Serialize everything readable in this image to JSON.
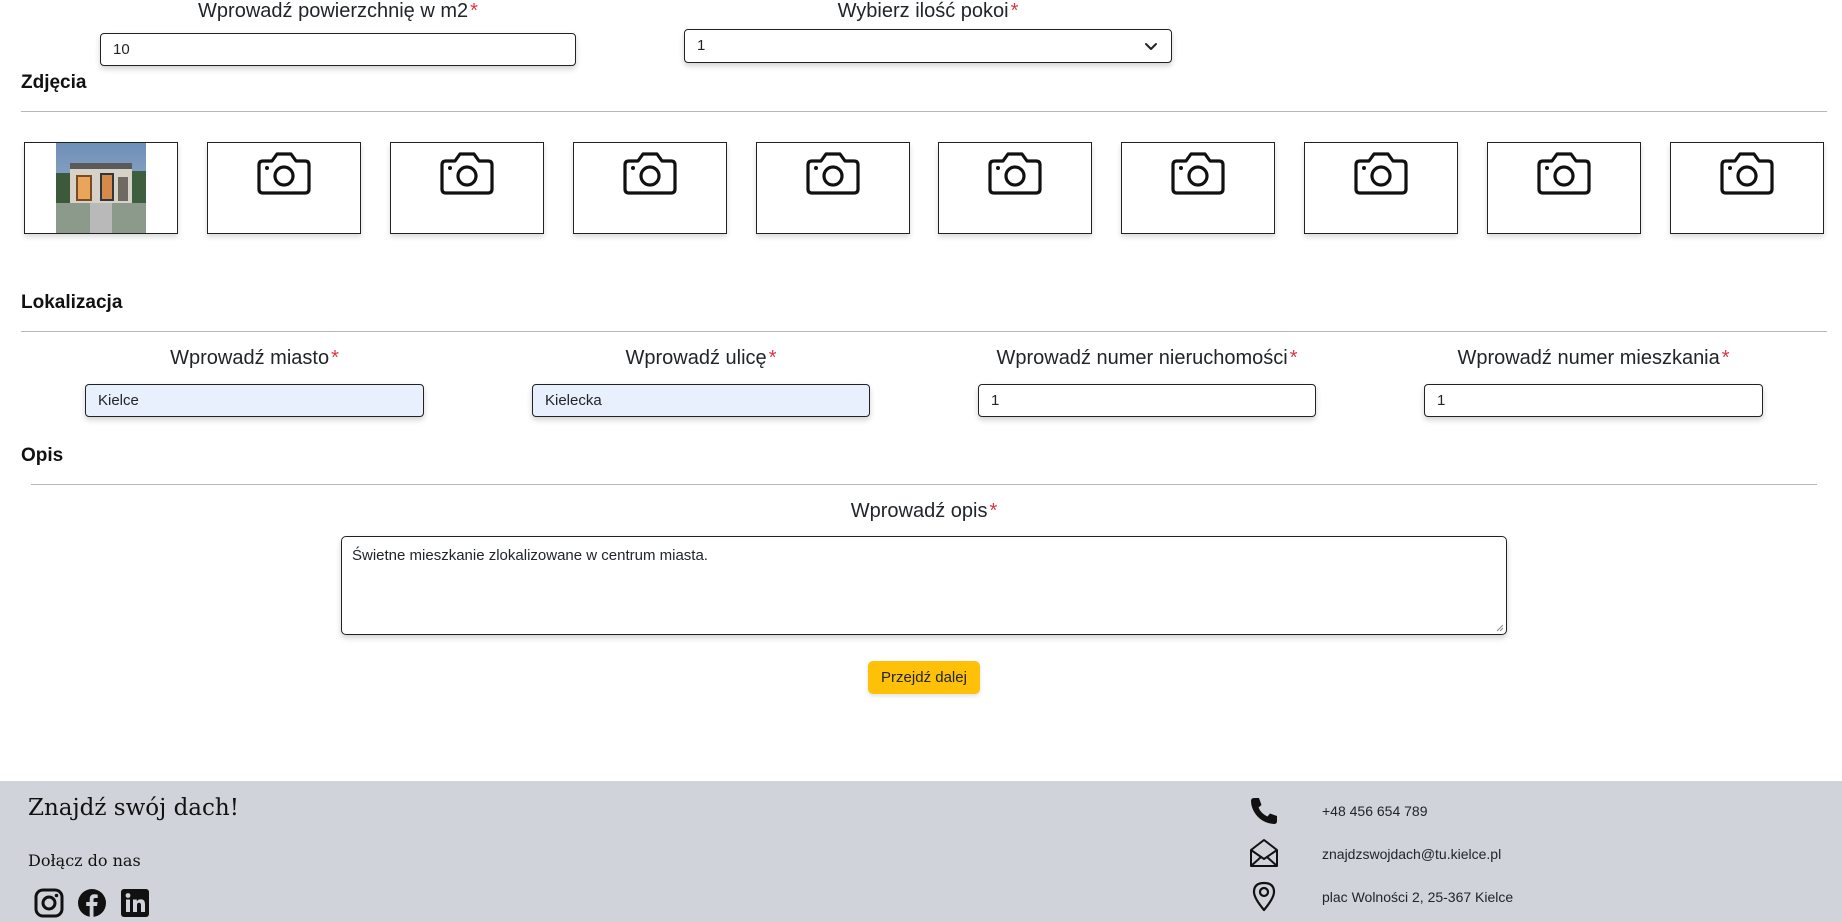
{
  "form": {
    "area": {
      "label": "Wprowadź powierzchnię w m2",
      "required": "*",
      "value": "10"
    },
    "rooms": {
      "label": "Wybierz ilość pokoi",
      "required": "*",
      "value": "1"
    }
  },
  "photos": {
    "title": "Zdjęcia",
    "slots": 10,
    "filled": 1,
    "icon": "camera-icon"
  },
  "location": {
    "title": "Lokalizacja",
    "city": {
      "label": "Wprowadź miasto",
      "required": "*",
      "value": "Kielce"
    },
    "street": {
      "label": "Wprowadź ulicę",
      "required": "*",
      "value": "Kielecka"
    },
    "property_number": {
      "label": "Wprowadź numer nieruchomości",
      "required": "*",
      "value": "1"
    },
    "apartment_number": {
      "label": "Wprowadź numer mieszkania",
      "required": "*",
      "value": "1"
    }
  },
  "description": {
    "title": "Opis",
    "label": "Wprowadź opis",
    "required": "*",
    "value": "Świetne mieszkanie zlokalizowane w centrum miasta."
  },
  "actions": {
    "next_label": "Przejdź dalej",
    "accent": "#ffc107"
  },
  "footer": {
    "brand": "Znajdź swój dach!",
    "join": "Dołącz do nas",
    "social": [
      "instagram-icon",
      "facebook-icon",
      "linkedin-icon"
    ],
    "phone": "+48 456 654 789",
    "email": "znajdzswojdach@tu.kielce.pl",
    "address": "plac Wolności 2, 25-367 Kielce",
    "background": "#d0d4da"
  }
}
